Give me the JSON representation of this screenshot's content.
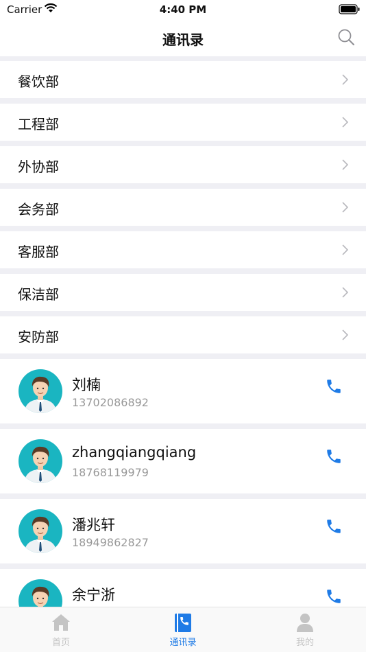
{
  "status_bar": {
    "carrier": "Carrier",
    "time": "4:40 PM"
  },
  "nav": {
    "title": "通讯录"
  },
  "departments": [
    {
      "label": "餐饮部"
    },
    {
      "label": "工程部"
    },
    {
      "label": "外协部"
    },
    {
      "label": "会务部"
    },
    {
      "label": "客服部"
    },
    {
      "label": "保洁部"
    },
    {
      "label": "安防部"
    }
  ],
  "contacts": [
    {
      "name": "刘楠",
      "phone": "13702086892"
    },
    {
      "name": "zhangqiangqiang",
      "phone": "18768119979"
    },
    {
      "name": "潘兆轩",
      "phone": "18949862827"
    },
    {
      "name": "余宁浙",
      "phone": ""
    }
  ],
  "tabs": [
    {
      "label": "首页",
      "icon": "home-icon"
    },
    {
      "label": "通讯录",
      "icon": "contacts-book-icon"
    },
    {
      "label": "我的",
      "icon": "person-icon"
    }
  ],
  "colors": {
    "accent": "#1f7be6",
    "avatar_bg": "#1ab5c1",
    "tab_inactive": "#c4c4c4"
  }
}
